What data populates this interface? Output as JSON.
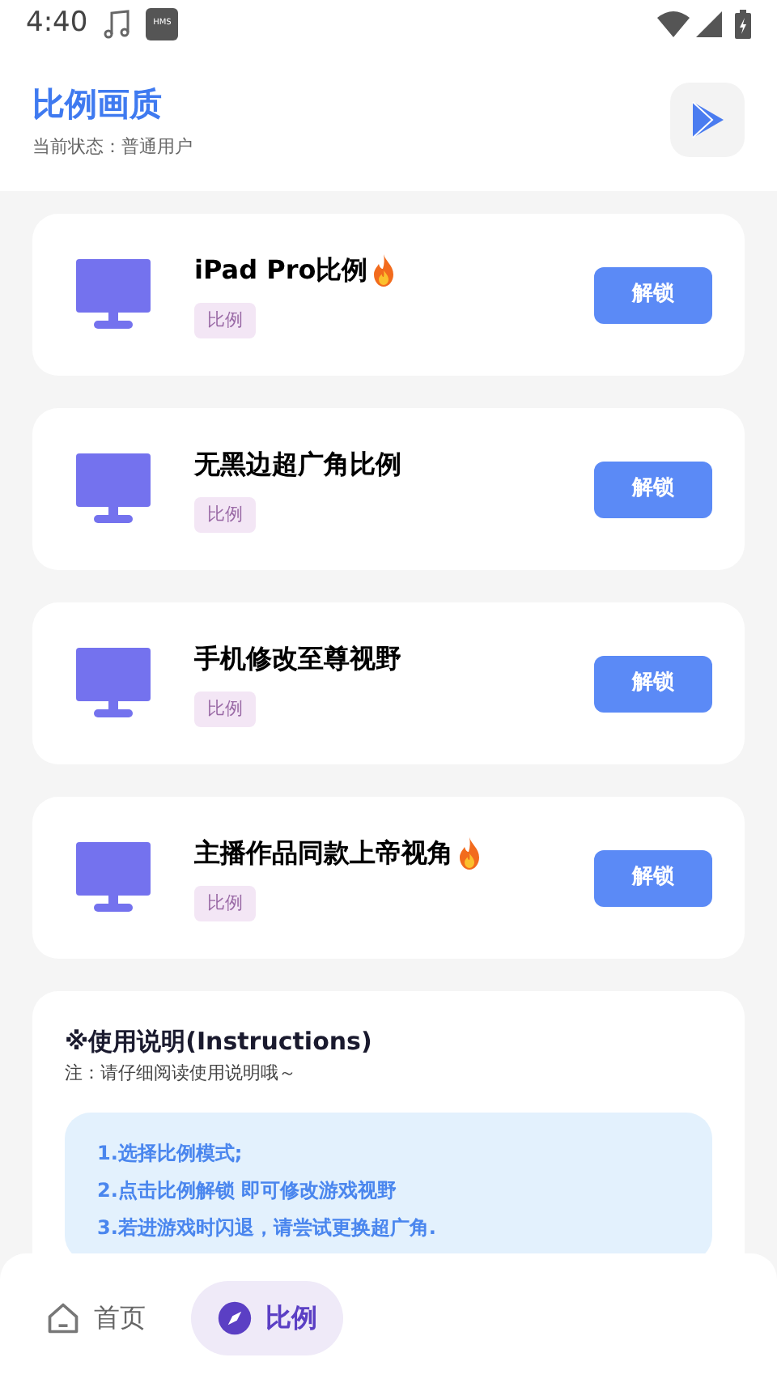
{
  "status_bar": {
    "time": "4:40",
    "badge": "HMS"
  },
  "header": {
    "title": "比例画质",
    "status": "当前状态：普通用户"
  },
  "items": [
    {
      "title": "iPad Pro比例",
      "hot": true,
      "tag": "比例",
      "button": "解锁"
    },
    {
      "title": "无黑边超广角比例",
      "hot": false,
      "tag": "比例",
      "button": "解锁"
    },
    {
      "title": "手机修改至尊视野",
      "hot": false,
      "tag": "比例",
      "button": "解锁"
    },
    {
      "title": "主播作品同款上帝视角",
      "hot": true,
      "tag": "比例",
      "button": "解锁"
    }
  ],
  "instructions": {
    "title": "※使用说明(Instructions)",
    "note": "注：请仔细阅读使用说明哦～",
    "steps": [
      "1.选择比例模式;",
      "2.点击比例解锁 即可修改游戏视野",
      "3.若进游戏时闪退，请尝试更换超广角."
    ]
  },
  "nav": [
    {
      "label": "首页",
      "kind": "home",
      "selected": false
    },
    {
      "label": "比例",
      "kind": "compass",
      "selected": true
    }
  ]
}
